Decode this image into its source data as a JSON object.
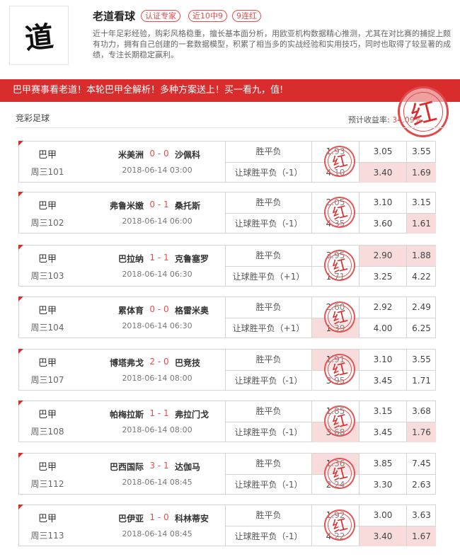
{
  "expert": {
    "avatar_char": "道",
    "name": "老道看球",
    "tags": [
      "认证专家",
      "近10中9",
      "9连红"
    ],
    "intro": "近十年足彩经验，购彩风格稳重，擅长基本面分析，用欧亚机构数据精心推测，尤其在对比赛的捕捉上颇有功力，拥有自己创建的一套数据模型，积累了相当多的实战经验和实用技巧，同时也取得了较显著的成绩，专注长期稳定赢利。"
  },
  "banner": {
    "text": "巴甲赛事看老道！本轮巴甲全解析！多种方案送上！买一看九，值!",
    "stamp": "红"
  },
  "section": {
    "title": "竞彩足球",
    "income_label": "预计收益率:",
    "income_value": "34.09%"
  },
  "labels": {
    "hit_stamp": "红"
  },
  "colors": {
    "accent": "#d92c2c",
    "hit_bg": "#f8dcdc"
  },
  "matches": [
    {
      "league": "巴甲",
      "no": "周三101",
      "home": "米美洲",
      "score": "0 - 0",
      "away": "沙佩科",
      "time": "2018-06-14 03:00",
      "type1": "胜平负",
      "odds1": [
        "1.93",
        "3.05",
        "3.55"
      ],
      "type2": "让球胜平负（-1）",
      "odds2": [
        "4.10",
        "3.40",
        "1.69"
      ],
      "hits": [
        [],
        [
          1,
          2
        ]
      ]
    },
    {
      "league": "巴甲",
      "no": "周三102",
      "home": "弗鲁米嫩",
      "score": "0 - 1",
      "away": "桑托斯",
      "time": "2018-06-14 06:00",
      "type1": "胜平负",
      "odds1": [
        "2.05",
        "3.10",
        "3.15"
      ],
      "type2": "让球胜平负（-1）",
      "odds2": [
        "4.35",
        "3.60",
        "1.61"
      ],
      "hits": [
        [],
        [
          2
        ]
      ]
    },
    {
      "league": "巴甲",
      "no": "周三103",
      "home": "巴拉纳",
      "score": "1 - 1",
      "away": "克鲁塞罗",
      "time": "2018-06-14 06:30",
      "type1": "胜平负",
      "odds1": [
        "3.95",
        "2.90",
        "1.88"
      ],
      "type2": "让球胜平负（+1）",
      "odds2": [
        "1.71",
        "3.25",
        "4.22"
      ],
      "hits": [
        [
          1,
          2
        ],
        []
      ]
    },
    {
      "league": "巴甲",
      "no": "周三104",
      "home": "累体育",
      "score": "0 - 0",
      "away": "格雷米奥",
      "time": "2018-06-14 06:30",
      "type1": "胜平负",
      "odds1": [
        "2.60",
        "2.92",
        "2.49"
      ],
      "type2": "让球胜平负（+1）",
      "odds2": [
        "1.39",
        "4.00",
        "6.25"
      ],
      "hits": [
        [],
        [
          0
        ]
      ]
    },
    {
      "league": "巴甲",
      "no": "周三107",
      "home": "博塔弗戈",
      "score": "2 - 0",
      "away": "巴竞技",
      "time": "2018-06-14 08:00",
      "type1": "胜平负",
      "odds1": [
        "1.91",
        "3.10",
        "3.55"
      ],
      "type2": "让球胜平负（-1）",
      "odds2": [
        "3.95",
        "3.45",
        "1.71"
      ],
      "hits": [
        [
          0
        ],
        []
      ]
    },
    {
      "league": "巴甲",
      "no": "周三108",
      "home": "帕梅拉斯",
      "score": "1 - 1",
      "away": "弗拉门戈",
      "time": "2018-06-14 08:00",
      "type1": "胜平负",
      "odds1": [
        "1.85",
        "3.15",
        "3.68"
      ],
      "type2": "让球胜平负（-1）",
      "odds2": [
        "3.68",
        "3.45",
        "1.76"
      ],
      "hits": [
        [],
        [
          0,
          2
        ]
      ]
    },
    {
      "league": "巴甲",
      "no": "周三112",
      "home": "巴西国际",
      "score": "3 - 1",
      "away": "达伽马",
      "time": "2018-06-14 08:45",
      "type1": "胜平负",
      "odds1": [
        "1.36",
        "3.85",
        "7.45"
      ],
      "type2": "让球胜平负（-1）",
      "odds2": [
        "2.24",
        "3.30",
        "2.63"
      ],
      "hits": [
        [
          0
        ],
        []
      ]
    },
    {
      "league": "巴甲",
      "no": "周三113",
      "home": "巴伊亚",
      "score": "1 - 0",
      "away": "科林蒂安",
      "time": "2018-06-14 08:45",
      "type1": "胜平负",
      "odds1": [
        "1.92",
        "3.00",
        "3.63"
      ],
      "type2": "让球胜平负（-1）",
      "odds2": [
        "4.22",
        "3.40",
        "1.67"
      ],
      "hits": [
        [],
        [
          1,
          2
        ]
      ]
    }
  ]
}
